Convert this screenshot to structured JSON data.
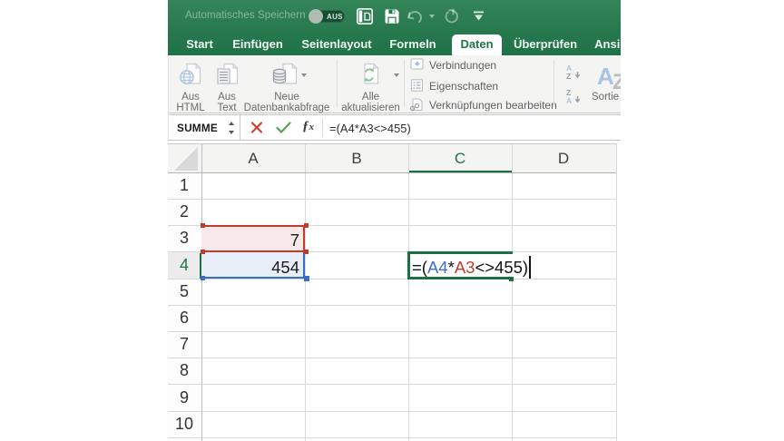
{
  "colors": {
    "excel_green": "#217346",
    "titlebar_green": "#2e7d52",
    "ref_blue": "#3e6fd0",
    "ref_blue_fill": "#e8eef8",
    "ref_red": "#bf3c30",
    "ref_red_fill": "#f8e9e8",
    "edit_border_green": "#1d6f44"
  },
  "titlebar": {
    "autosave_label": "Automatisches Speichern",
    "autosave_state": "AUS",
    "icons": [
      "show-ribbon-panel-icon",
      "save-icon",
      "undo-icon",
      "undo-dropdown-caret",
      "redo-icon",
      "toolbar-overflow-icon"
    ]
  },
  "tabs": [
    {
      "label": "Start"
    },
    {
      "label": "Einfügen"
    },
    {
      "label": "Seitenlayout"
    },
    {
      "label": "Formeln"
    },
    {
      "label": "Daten"
    },
    {
      "label": "Überprüfen"
    },
    {
      "label": "Ansicht"
    }
  ],
  "active_tab": "Daten",
  "ribbon": {
    "buttons": [
      {
        "label_line1": "Aus",
        "label_line2": "HTML",
        "icon": "import-html-icon"
      },
      {
        "label_line1": "Aus",
        "label_line2": "Text",
        "icon": "import-text-icon"
      },
      {
        "label_line1": "Neue",
        "label_line2": "Datenbankabfrage",
        "icon": "new-database-query-icon",
        "has_dropdown": true
      },
      {
        "label_line1": "Alle",
        "label_line2": "aktualisieren",
        "icon": "refresh-all-icon",
        "has_dropdown": true
      }
    ],
    "connection_items": [
      {
        "label": "Verbindungen",
        "icon": "connections-icon"
      },
      {
        "label": "Eigenschaften",
        "icon": "properties-icon"
      },
      {
        "label": "Verknüpfungen bearbeiten",
        "icon": "edit-links-icon"
      }
    ],
    "sort_asc_icon": "sort-az-icon",
    "sort_desc_icon": "sort-za-icon",
    "sort_label": "Sortie"
  },
  "formula_bar": {
    "name_box": "SUMME",
    "cancel_icon": "cancel-x-icon",
    "confirm_icon": "confirm-check-icon",
    "fx_icon": "insert-function-icon",
    "formula": "=(A4*A3<>455)"
  },
  "grid": {
    "column_labels": [
      "A",
      "B",
      "C",
      "D"
    ],
    "row_labels": [
      "1",
      "2",
      "3",
      "4",
      "5",
      "6",
      "7",
      "8",
      "9",
      "10"
    ],
    "selected_column": "C",
    "selected_row": "4",
    "cells": [
      {
        "ref": "A3",
        "value": "7",
        "highlight": "red"
      },
      {
        "ref": "A4",
        "value": "454",
        "highlight": "blue"
      }
    ],
    "edit_cell": {
      "ref": "C4",
      "formula_parts": [
        {
          "text": "=(",
          "color": "black"
        },
        {
          "text": "A4",
          "color": "blue"
        },
        {
          "text": "*",
          "color": "black"
        },
        {
          "text": "A3",
          "color": "red"
        },
        {
          "text": "<>455)",
          "color": "black"
        }
      ]
    }
  }
}
